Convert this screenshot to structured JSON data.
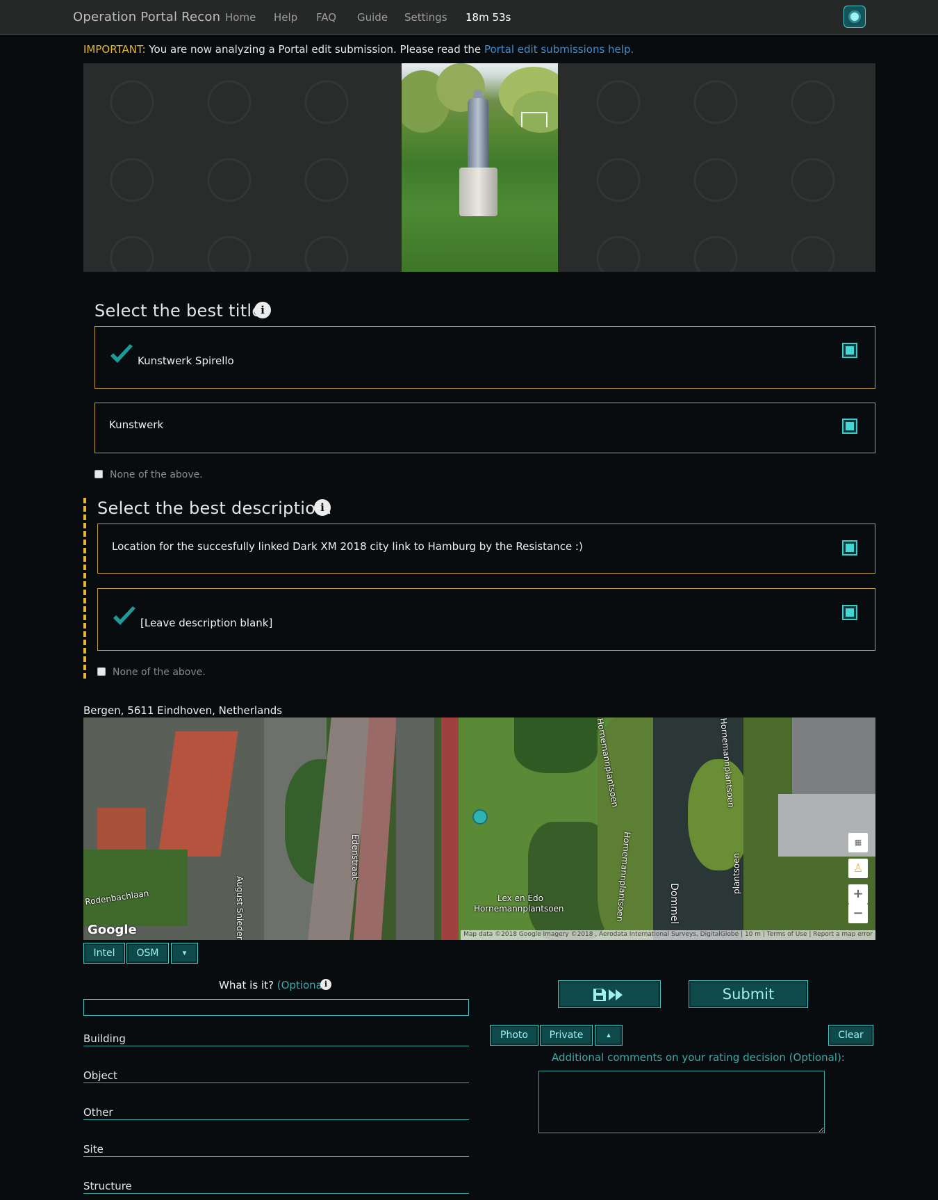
{
  "nav": {
    "brand": "Operation Portal Recon",
    "items": [
      "Home",
      "Help",
      "FAQ",
      "Guide",
      "Settings"
    ],
    "timer": "18m 53s",
    "avatar_icon": "agent-avatar-icon"
  },
  "notice": {
    "label": "IMPORTANT:",
    "text": " You are now analyzing a Portal edit submission. Please read the ",
    "link": "Portal edit submissions help."
  },
  "title_section": {
    "heading": "Select the best title:",
    "options": [
      {
        "text": "Kunstwerk Spirello",
        "selected": true
      },
      {
        "text": "Kunstwerk",
        "selected": false
      }
    ],
    "none_label": "None of the above."
  },
  "description_section": {
    "heading": "Select the best description:",
    "options": [
      {
        "text": "Location for the succesfully linked Dark XM 2018 city link to Hamburg by the Resistance :)",
        "selected": false
      },
      {
        "text": "[Leave description blank]",
        "selected": true
      }
    ],
    "none_label": "None of the above."
  },
  "location": {
    "address": "Bergen, 5611 Eindhoven, Netherlands",
    "map_labels": {
      "edenstraat": "Edenstraat",
      "rodenbachlaan": "Rodenbachlaan",
      "august": "August Snieders",
      "park": "Lex en Edo",
      "park2": "Hornemannplantsoen",
      "horne1": "Hornemannplantsoen",
      "horne2": "Hornemannplantsoen",
      "horne3": "Hornemannplantsoen",
      "horne4": "plantsoen",
      "dommel": "Dommel"
    },
    "google": "Google",
    "attribution": "Map data ©2018 Google Imagery ©2018 , Aerodata International Surveys, DigitalGlobe",
    "scale": "10 m",
    "terms": "Terms of Use",
    "report": "Report a map error",
    "zoom_in": "+",
    "zoom_out": "−"
  },
  "map_buttons": {
    "intel": "Intel",
    "osm": "OSM",
    "dropdown": "▾"
  },
  "what_is_it": {
    "label": "What is it?",
    "optional": " (Optional)",
    "input_value": "",
    "categories": [
      "Building",
      "Object",
      "Other",
      "Site",
      "Structure"
    ]
  },
  "actions": {
    "save_skip_icon": "save-and-skip-icon",
    "submit": "Submit",
    "photo": "Photo",
    "private": "Private",
    "collapse": "▴",
    "clear": "Clear",
    "comments_label": "Additional comments on your rating decision (Optional):",
    "comments_value": ""
  },
  "colors": {
    "accent": "#45c8c8",
    "gold": "#c8a03a",
    "important": "#e5b733",
    "link": "#3f8fd1"
  }
}
